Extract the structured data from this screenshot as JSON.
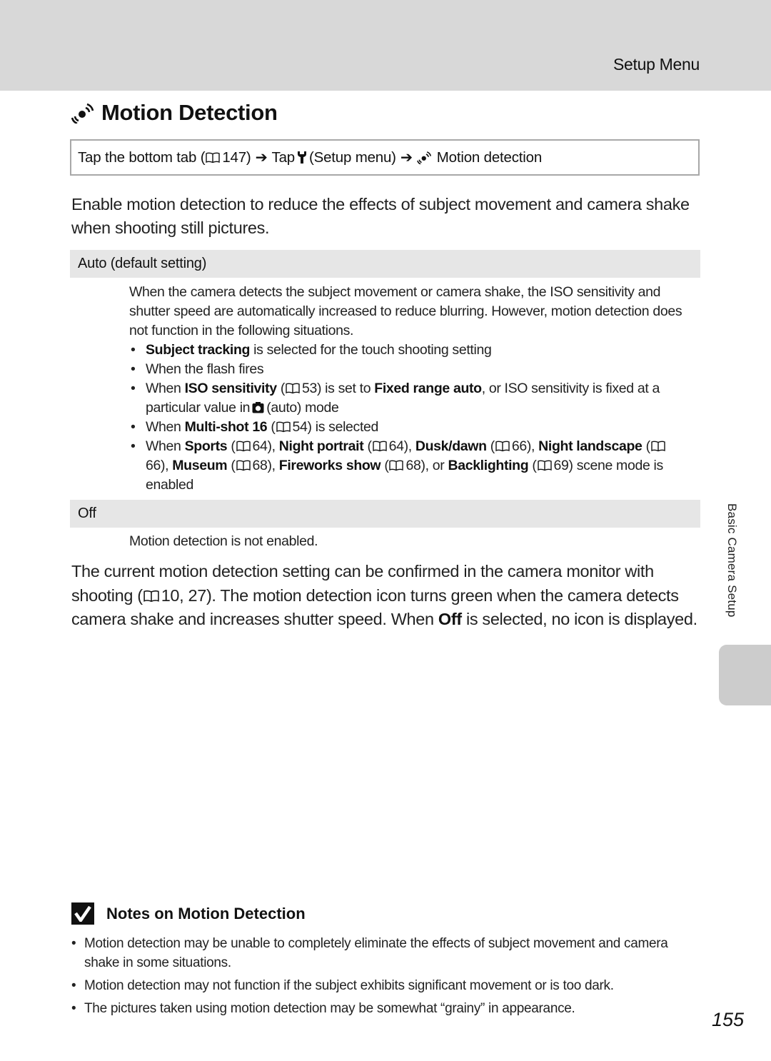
{
  "header": {
    "section_label": "Setup Menu",
    "title": "Motion Detection",
    "title_icon": "motion-detection-icon"
  },
  "nav_path": {
    "step1": "Tap the bottom tab (",
    "step1_page": "147)",
    "step2": "Tap",
    "step2_icon": "wrench-setup-icon",
    "step2_label": "(Setup menu)",
    "step3_icon": "motion-detection-icon",
    "step3_label": "Motion detection",
    "arrow_glyph": "➔"
  },
  "intro": "Enable motion detection to reduce the effects of subject movement and camera shake when shooting still pictures.",
  "options": [
    {
      "label": "Auto (default setting)",
      "description": "When the camera detects the subject movement or camera shake, the ISO sensitivity and shutter speed are automatically increased to reduce blurring. However, motion detection does not function in the following situations.",
      "bullets": {
        "b1_bold": "Subject tracking",
        "b1_text": " is selected for the touch shooting setting",
        "b2_text": "When the flash fires",
        "b3_pre": "When ",
        "b3_bold1": "ISO sensitivity",
        "b3_ref1": "53) is set to ",
        "b3_bold2": "Fixed range auto",
        "b3_text": ", or ISO sensitivity is fixed at a particular value in",
        "b3_tail": "(auto) mode",
        "b4_pre": "When ",
        "b4_bold": "Multi-shot 16",
        "b4_ref": "54) is selected",
        "b5_pre": "When ",
        "b5_sports": "Sports",
        "b5_sports_ref": "64), ",
        "b5_night_portrait": "Night portrait",
        "b5_night_portrait_ref": "64), ",
        "b5_dusk": "Dusk/dawn",
        "b5_dusk_ref": "66), ",
        "b5_night_landscape": "Night landscape",
        "b5_night_landscape_ref": "66), ",
        "b5_museum": "Museum",
        "b5_museum_ref": "68), ",
        "b5_fireworks": "Fireworks show",
        "b5_fireworks_ref": "68), or ",
        "b5_backlighting": "Backlighting",
        "b5_backlighting_ref": "69) scene mode is enabled"
      }
    },
    {
      "label": "Off",
      "description": "Motion detection is not enabled."
    }
  ],
  "monitor_note": {
    "pre": "The current motion detection setting can be confirmed in the camera monitor with shooting (",
    "ref": "10, 27). The motion detection icon turns green when the camera detects camera shake and increases shutter speed. When ",
    "bold": "Off",
    "post": " is selected, no icon is displayed."
  },
  "side_tab": {
    "label": "Basic Camera Setup"
  },
  "notes": {
    "heading": "Notes on Motion Detection",
    "icon": "checkmark-icon",
    "items": [
      "Motion detection may be unable to completely eliminate the effects of subject movement and camera shake in some situations.",
      "Motion detection may not function if the subject exhibits significant movement or is too dark.",
      "The pictures taken using motion detection may be somewhat “grainy” in appearance."
    ]
  },
  "page_number": "155",
  "colors": {
    "header_band": "#d8d8d8",
    "option_header": "#e6e6e6",
    "thumb_tab": "#cccccc",
    "nav_border": "#a8a8a8"
  }
}
